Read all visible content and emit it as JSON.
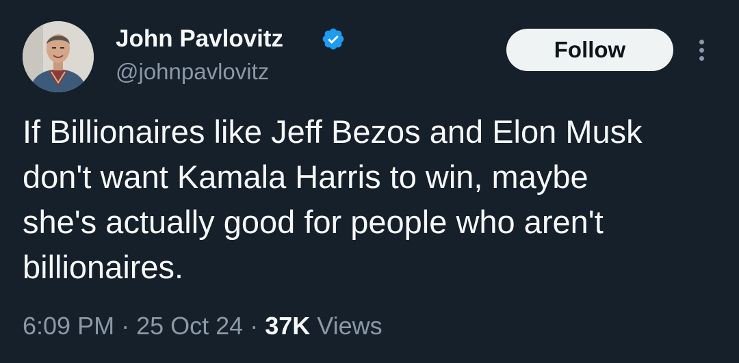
{
  "author": {
    "display_name": "John Pavlovitz",
    "handle": "@johnpavlovitz",
    "verified": true
  },
  "actions": {
    "follow_label": "Follow"
  },
  "tweet": {
    "lines": [
      "If Billionaires like Jeff Bezos and Elon Musk",
      "don't want Kamala Harris to win, maybe",
      "she's actually good for people who aren't",
      "billionaires."
    ]
  },
  "meta": {
    "time": "6:09 PM",
    "separator": "·",
    "date": "25 Oct 24",
    "views_count": "37K",
    "views_label": "Views"
  },
  "colors": {
    "background": "#15202b",
    "primary_text": "#f7f9f9",
    "secondary_text": "#8b98a5",
    "verified": "#1d9bf0",
    "follow_bg": "#eff3f4"
  },
  "icons": {
    "verified": "verified-badge-icon",
    "more": "more-vertical-icon"
  }
}
